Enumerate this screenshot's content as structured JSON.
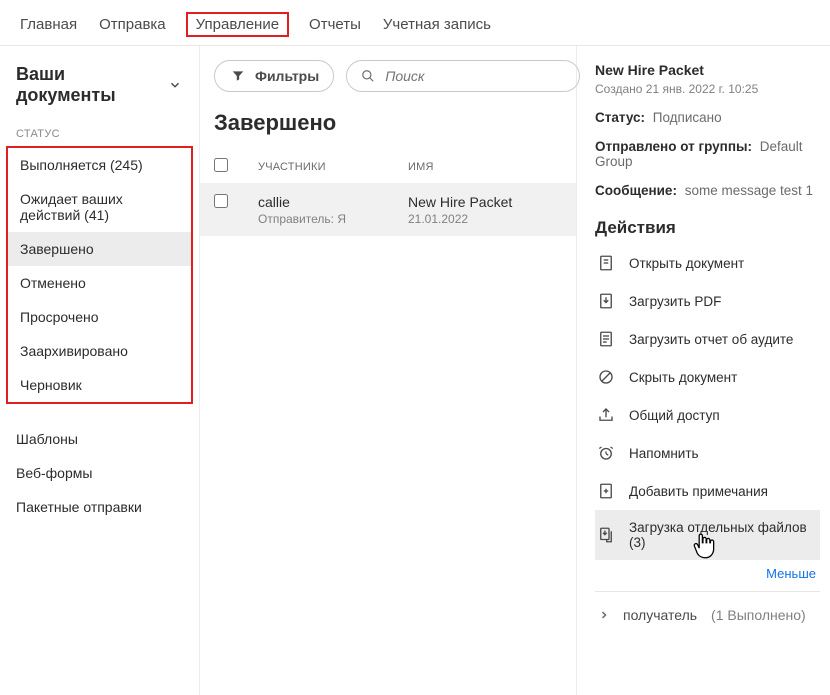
{
  "topnav": {
    "items": [
      "Главная",
      "Отправка",
      "Управление",
      "Отчеты",
      "Учетная запись"
    ],
    "active_index": 2
  },
  "sidebar": {
    "heading": "Ваши документы",
    "section_label": "СТАТУС",
    "status_items": [
      "Выполняется (245)",
      "Ожидает ваших действий (41)",
      "Завершено",
      "Отменено",
      "Просрочено",
      "Заархивировано",
      "Черновик"
    ],
    "active_status_index": 2,
    "extra_items": [
      "Шаблоны",
      "Веб-формы",
      "Пакетные отправки"
    ]
  },
  "center": {
    "filter_label": "Фильтры",
    "search_placeholder": "Поиск",
    "heading": "Завершено",
    "columns": {
      "participants": "УЧАСТНИКИ",
      "name": "ИМЯ"
    },
    "rows": [
      {
        "participant": "callie",
        "participant_sub": "Отправитель: Я",
        "name": "New Hire Packet",
        "date": "21.01.2022"
      }
    ]
  },
  "details": {
    "title": "New Hire Packet",
    "created_prefix": "Создано",
    "created": "21 янв. 2022 г. 10:25",
    "status_label": "Статус:",
    "status_value": "Подписано",
    "sent_from_label": "Отправлено от группы:",
    "sent_from_value": "Default Group",
    "message_label": "Сообщение:",
    "message_value": "some message test 1",
    "actions_heading": "Действия",
    "actions": [
      "Открыть документ",
      "Загрузить PDF",
      "Загрузить отчет об аудите",
      "Скрыть документ",
      "Общий доступ",
      "Напомнить",
      "Добавить примечания",
      "Загрузка отдельных файлов (3)"
    ],
    "less_label": "Меньше",
    "recipient_label": "получатель",
    "recipient_count": "(1 Выполнено)"
  }
}
